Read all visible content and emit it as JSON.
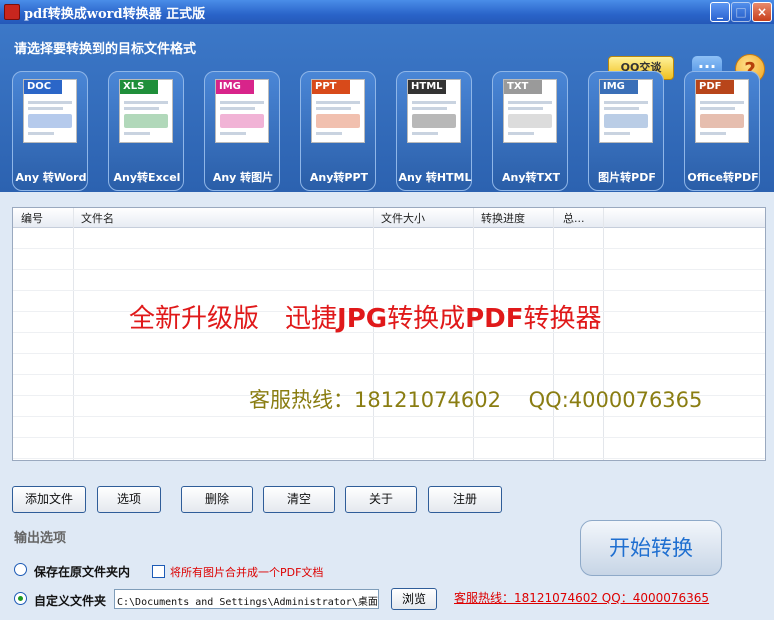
{
  "window": {
    "title": "pdf转换成word转换器 正式版",
    "min_label": "_",
    "max_label": "□",
    "close_label": "×"
  },
  "header": {
    "prompt": "请选择要转换到的目标文件格式",
    "qq_button": "QQ交谈",
    "chat_label": "···",
    "help_label": "?"
  },
  "formats": [
    {
      "tag": "DOC",
      "tag_color": "#2b66c8",
      "label": "Any 转Word",
      "icon": "word-doc-icon"
    },
    {
      "tag": "XLS",
      "tag_color": "#1f8f3a",
      "label": "Any转Excel",
      "icon": "excel-chart-icon"
    },
    {
      "tag": "IMG",
      "tag_color": "#d8248a",
      "label": "Any 转图片",
      "icon": "image-icon"
    },
    {
      "tag": "PPT",
      "tag_color": "#d84a1a",
      "label": "Any转PPT",
      "icon": "ppt-icon"
    },
    {
      "tag": "HTML",
      "tag_color": "#333333",
      "label": "Any 转HTML",
      "icon": "html-globe-icon"
    },
    {
      "tag": "TXT",
      "tag_color": "#9a9a9a",
      "label": "Any转TXT",
      "icon": "txt-icon"
    },
    {
      "tag": "IMG",
      "tag_color": "#3a6fb8",
      "label": "图片转PDF",
      "icon": "image-to-pdf-icon"
    },
    {
      "tag": "PDF",
      "tag_color": "#b8451a",
      "label": "Office转PDF",
      "icon": "office-to-pdf-icon"
    }
  ],
  "table": {
    "columns": [
      "编号",
      "文件名",
      "文件大小",
      "转换进度",
      "总..."
    ],
    "rows": []
  },
  "overlay": {
    "line1_prefix": "全新升级版　迅捷",
    "line1_bold": "JPG",
    "line1_mid": "转换成",
    "line1_bold2": "PDF",
    "line1_suffix": "转换器",
    "line2": "客服热线：18121074602　  QQ:4000076365"
  },
  "actions": {
    "add_file": "添加文件",
    "options": "选项",
    "delete": "删除",
    "clear": "清空",
    "about": "关于",
    "register": "注册"
  },
  "output": {
    "title": "输出选项",
    "radio_original": "保存在原文件夹内",
    "merge_checkbox": "将所有图片合并成一个PDF文档",
    "radio_custom": "自定义文件夹",
    "path_value": "C:\\Documents and Settings\\Administrator\\桌面",
    "browse": "浏览",
    "hotline": "客服热线：18121074602 QQ：4000076365",
    "start": "开始转换"
  },
  "colors": {
    "title_bar": "#2a64c9",
    "header_bg": "#3c78c8",
    "overlay_red": "#e0191a",
    "overlay_olive": "#8a7d12",
    "start_text": "#1f6fd0"
  }
}
